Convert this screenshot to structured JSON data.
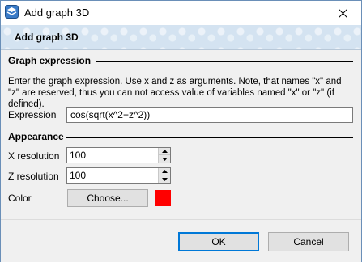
{
  "window": {
    "title": "Add graph 3D"
  },
  "header": {
    "title": "Add graph 3D"
  },
  "graph_expression": {
    "section_title": "Graph expression",
    "description": "Enter the graph expression. Use x and z as arguments. Note, that names \"x\" and \"z\" are reserved, thus you can not access value of variables named \"x\" or \"z\" (if defined).",
    "expression_label": "Expression",
    "expression_value": "cos(sqrt(x^2+z^2))"
  },
  "appearance": {
    "section_title": "Appearance",
    "x_resolution_label": "X resolution",
    "x_resolution_value": "100",
    "z_resolution_label": "Z resolution",
    "z_resolution_value": "100",
    "color_label": "Color",
    "choose_label": "Choose...",
    "color_value": "#ff0000"
  },
  "footer": {
    "ok_label": "OK",
    "cancel_label": "Cancel"
  },
  "icons": {
    "app": "graph-app-icon",
    "close": "close-icon",
    "spin_up": "chevron-up-icon",
    "spin_down": "chevron-down-icon"
  }
}
